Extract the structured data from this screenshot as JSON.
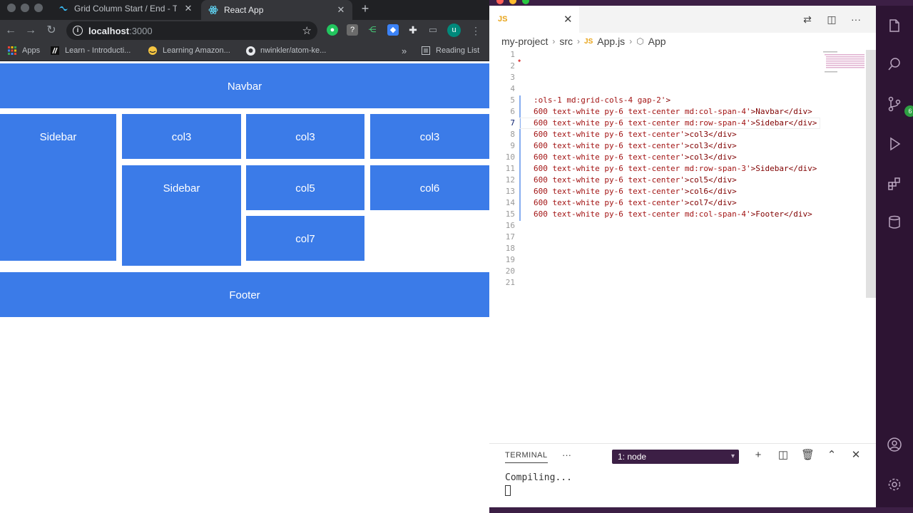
{
  "browser": {
    "tabs": [
      {
        "title": "Grid Column Start / End - Tailw",
        "active": false
      },
      {
        "title": "React App",
        "active": true
      }
    ],
    "address": {
      "host": "localhost",
      "port": ":3000"
    },
    "bookmarks": [
      {
        "label": "Apps",
        "icon": "apps-grid-icon"
      },
      {
        "label": "Learn - Introducti...",
        "icon": "learn-icon"
      },
      {
        "label": "Learning Amazon...",
        "icon": "aws-icon"
      },
      {
        "label": "nwinkler/atom-ke...",
        "icon": "github-icon"
      },
      {
        "label": "»",
        "icon": ""
      },
      {
        "label": "Reading List",
        "icon": "reading-list-icon"
      }
    ],
    "profile_initial": "u"
  },
  "page": {
    "navbar": "Navbar",
    "sidebar_1": "Sidebar",
    "col3_a": "col3",
    "col3_b": "col3",
    "col3_c": "col3",
    "sidebar_2": "Sidebar",
    "col5": "col5",
    "col6": "col6",
    "col7": "col7",
    "footer": "Footer",
    "cell_color": "#3b7be8"
  },
  "editor": {
    "tab_label": "JS",
    "breadcrumb": [
      "my-project",
      "src",
      "App.js",
      "App"
    ],
    "active_line": 7,
    "line_numbers": [
      "1",
      "2",
      "3",
      "4",
      "5",
      "6",
      "7",
      "8",
      "9",
      "10",
      "11",
      "12",
      "13",
      "14",
      "15",
      "16",
      "17",
      "18",
      "19",
      "20",
      "21"
    ],
    "lines": [
      {
        "n": 5,
        "cls": ":ols-1 md:grid-cols-4 gap-2'",
        "tail": ">"
      },
      {
        "n": 6,
        "cls": "600 text-white py-6 text-center md:col-span-4'",
        "tail": ">Navbar</div>"
      },
      {
        "n": 7,
        "cls": "600 text-white py-6 text-center md:row-span-4'",
        "tail": ">Sidebar</div>"
      },
      {
        "n": 8,
        "cls": "600 text-white py-6 text-center'",
        "tail": ">col3</div>"
      },
      {
        "n": 9,
        "cls": "600 text-white py-6 text-center'",
        "tail": ">col3</div>"
      },
      {
        "n": 10,
        "cls": "600 text-white py-6 text-center'",
        "tail": ">col3</div>"
      },
      {
        "n": 11,
        "cls": "600 text-white py-6 text-center md:row-span-3'",
        "tail": ">Sidebar</div>"
      },
      {
        "n": 12,
        "cls": "600 text-white py-6 text-center'",
        "tail": ">col5</div>"
      },
      {
        "n": 13,
        "cls": "600 text-white py-6 text-center'",
        "tail": ">col6</div>"
      },
      {
        "n": 14,
        "cls": "600 text-white py-6 text-center'",
        "tail": ">col7</div>"
      },
      {
        "n": 15,
        "cls": "600 text-white py-6 text-center md:col-span-4'",
        "tail": ">Footer</div>"
      }
    ],
    "accent": "#3c1f45"
  },
  "terminal": {
    "title": "TERMINAL",
    "dots": "···",
    "selected": "1: node",
    "output": "Compiling..."
  },
  "activity": {
    "scm_badge": "6"
  }
}
